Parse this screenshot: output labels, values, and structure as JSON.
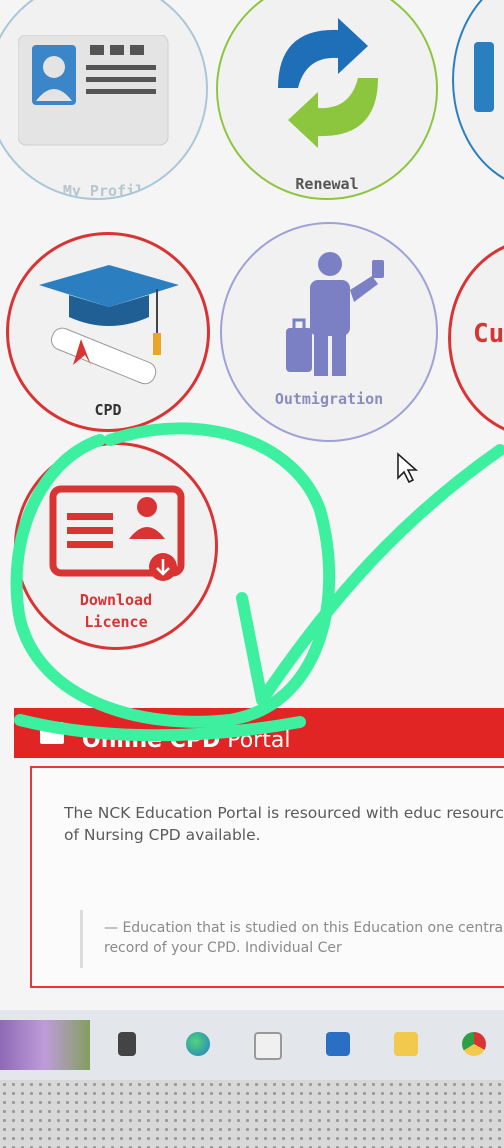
{
  "tiles": {
    "my_profile": "My Profile",
    "renewal": "Renewal",
    "cpd": "CPD",
    "outmigration": "Outmigration",
    "partial_right": "Cu",
    "download_licence_line1": "Download",
    "download_licence_line2": "Licence"
  },
  "cpd_portal": {
    "title_bold": "Online CPD",
    "title_regular": " Portal",
    "description": "The NCK Education Portal is resourced with educ resource of Nursing CPD available.",
    "quote": "— Education that is studied on this Education one central record of your CPD. Individual Cer"
  },
  "colors": {
    "brand_red": "#e12424",
    "profile_border": "#a9c7d6",
    "renewal_blue": "#1f6fb8",
    "renewal_green": "#8cc63f",
    "outmigration_purple": "#7b7fc4",
    "annotation_green": "#3cf0a0"
  },
  "icons": {
    "profile": "id-card-icon",
    "renewal": "refresh-arrows-icon",
    "cpd": "graduation-cap-icon",
    "outmigration": "traveler-icon",
    "download": "licence-card-icon",
    "cursor": "mouse-pointer-icon"
  }
}
